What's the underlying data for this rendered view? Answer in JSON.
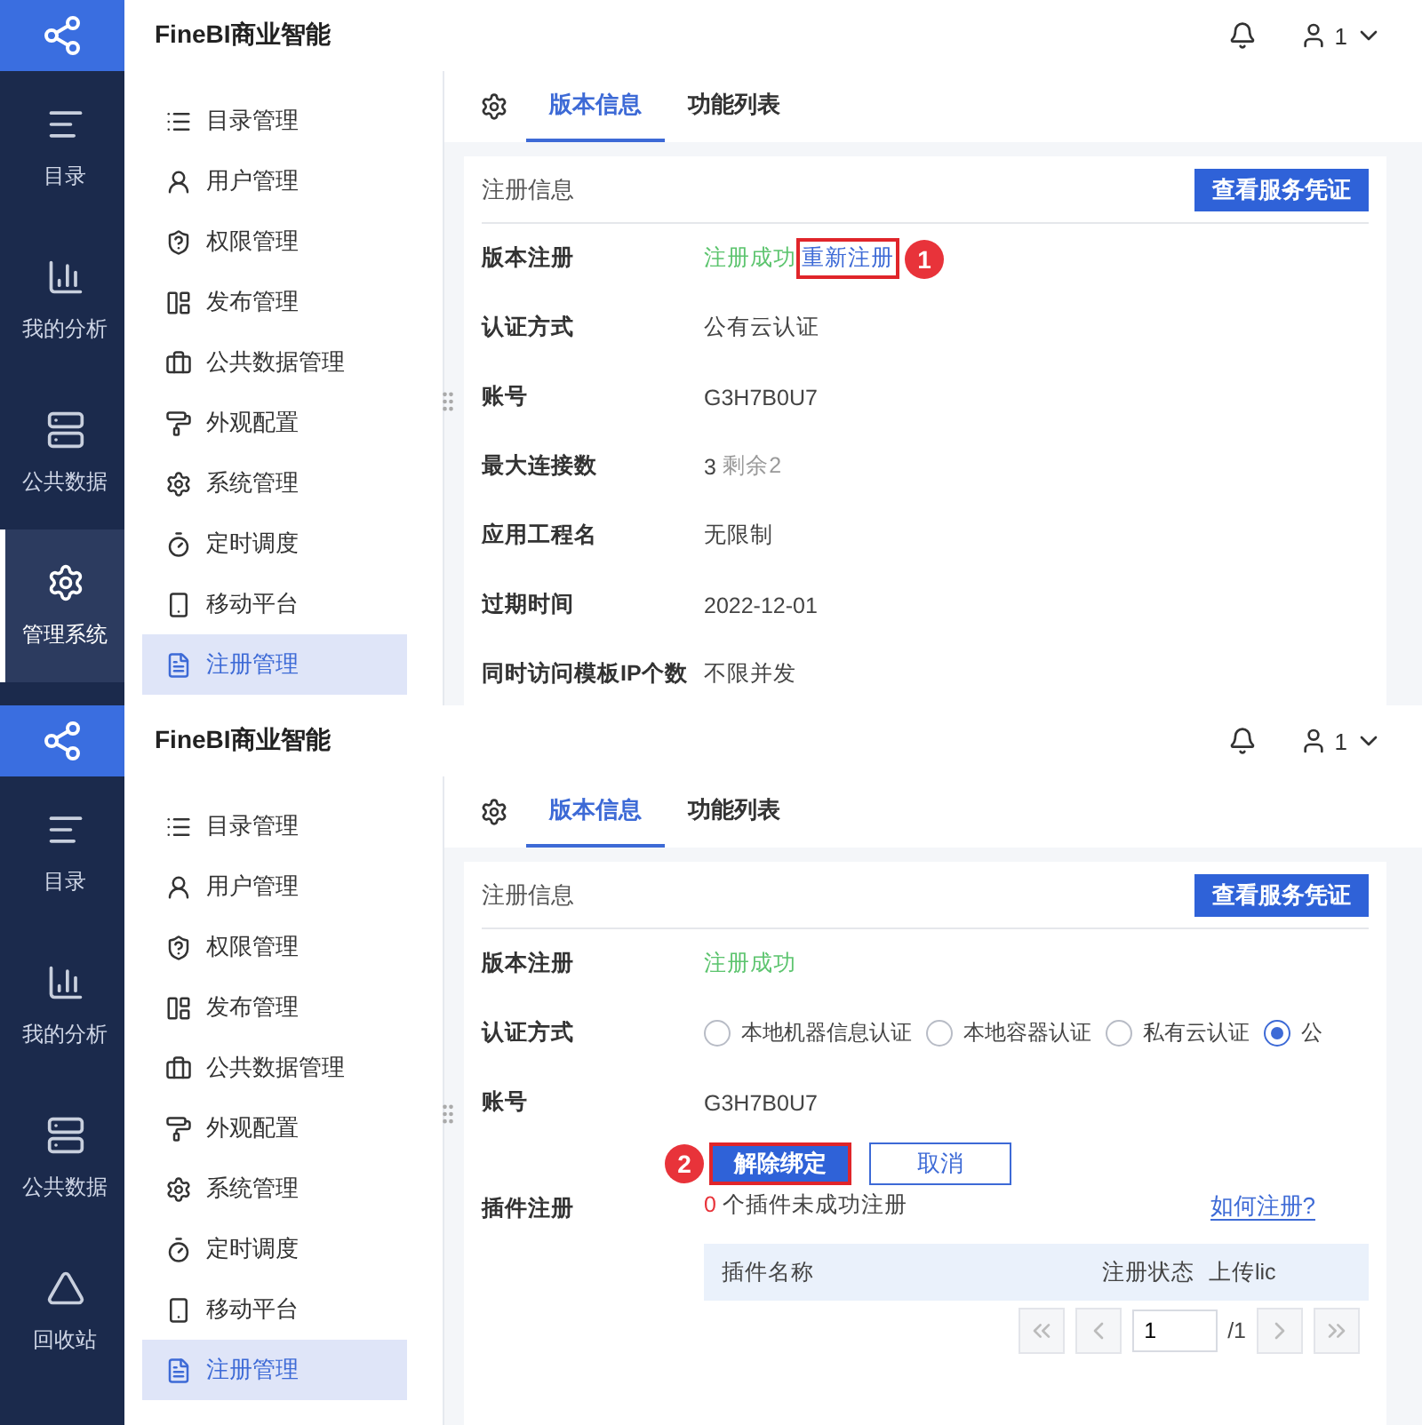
{
  "panels": [
    {
      "brand": "FineBI商业智能",
      "user": "1",
      "rail": [
        {
          "label": "目录",
          "kind": "catalog",
          "selected": false
        },
        {
          "label": "我的分析",
          "kind": "analysis",
          "selected": false
        },
        {
          "label": "公共数据",
          "kind": "data",
          "selected": false
        },
        {
          "label": "管理系统",
          "kind": "admin",
          "selected": true
        }
      ],
      "menu": [
        {
          "label": "目录管理",
          "selected": false
        },
        {
          "label": "用户管理",
          "selected": false
        },
        {
          "label": "权限管理",
          "selected": false
        },
        {
          "label": "发布管理",
          "selected": false
        },
        {
          "label": "公共数据管理",
          "selected": false
        },
        {
          "label": "外观配置",
          "selected": false
        },
        {
          "label": "系统管理",
          "selected": false
        },
        {
          "label": "定时调度",
          "selected": false
        },
        {
          "label": "移动平台",
          "selected": false
        },
        {
          "label": "注册管理",
          "selected": true
        }
      ],
      "tabs": [
        {
          "label": "版本信息",
          "selected": true
        },
        {
          "label": "功能列表",
          "selected": false
        }
      ],
      "section_title": "注册信息",
      "section_button": "查看服务凭证",
      "rows": [
        {
          "kind": "status",
          "label": "版本注册",
          "status": "注册成功",
          "link": "重新注册",
          "marker": "1"
        },
        {
          "kind": "text",
          "label": "认证方式",
          "value": "公有云认证"
        },
        {
          "kind": "text",
          "label": "账号",
          "value": "G3H7B0U7"
        },
        {
          "kind": "limit",
          "label": "最大连接数",
          "value": "3",
          "note": "剩余2"
        },
        {
          "kind": "text",
          "label": "应用工程名",
          "value": "无限制"
        },
        {
          "kind": "text",
          "label": "过期时间",
          "value": "2022-12-01"
        },
        {
          "kind": "text",
          "label": "同时访问模板IP个数",
          "value": "不限并发"
        }
      ]
    },
    {
      "brand": "FineBI商业智能",
      "user": "1",
      "rail": [
        {
          "label": "目录",
          "kind": "catalog",
          "selected": false
        },
        {
          "label": "我的分析",
          "kind": "analysis",
          "selected": false
        },
        {
          "label": "公共数据",
          "kind": "data",
          "selected": false
        },
        {
          "label": "回收站",
          "kind": "recycle",
          "selected": false
        }
      ],
      "menu": [
        {
          "label": "目录管理",
          "selected": false
        },
        {
          "label": "用户管理",
          "selected": false
        },
        {
          "label": "权限管理",
          "selected": false
        },
        {
          "label": "发布管理",
          "selected": false
        },
        {
          "label": "公共数据管理",
          "selected": false
        },
        {
          "label": "外观配置",
          "selected": false
        },
        {
          "label": "系统管理",
          "selected": false
        },
        {
          "label": "定时调度",
          "selected": false
        },
        {
          "label": "移动平台",
          "selected": false
        },
        {
          "label": "注册管理",
          "selected": true
        }
      ],
      "tabs": [
        {
          "label": "版本信息",
          "selected": true
        },
        {
          "label": "功能列表",
          "selected": false
        }
      ],
      "section_title": "注册信息",
      "section_button": "查看服务凭证",
      "rows": [
        {
          "kind": "status",
          "label": "版本注册",
          "status": "注册成功"
        },
        {
          "kind": "radio",
          "label": "认证方式",
          "options": [
            {
              "label": "本地机器信息认证",
              "selected": false
            },
            {
              "label": "本地容器认证",
              "selected": false
            },
            {
              "label": "私有云认证",
              "selected": false
            },
            {
              "label": "公",
              "selected": true
            }
          ]
        },
        {
          "kind": "text",
          "label": "账号",
          "value": "G3H7B0U7"
        },
        {
          "kind": "actions",
          "buttons": [
            {
              "label": "解除绑定",
              "primary": true,
              "marker": "2"
            },
            {
              "label": "取消",
              "primary": false
            }
          ]
        },
        {
          "kind": "plugins",
          "label": "插件注册",
          "count": "0",
          "summary": "个插件未成功注册",
          "link": "如何注册?",
          "columns": [
            "插件名称",
            "注册状态",
            "上传lic"
          ],
          "page": "1",
          "total": "/1"
        }
      ]
    }
  ]
}
